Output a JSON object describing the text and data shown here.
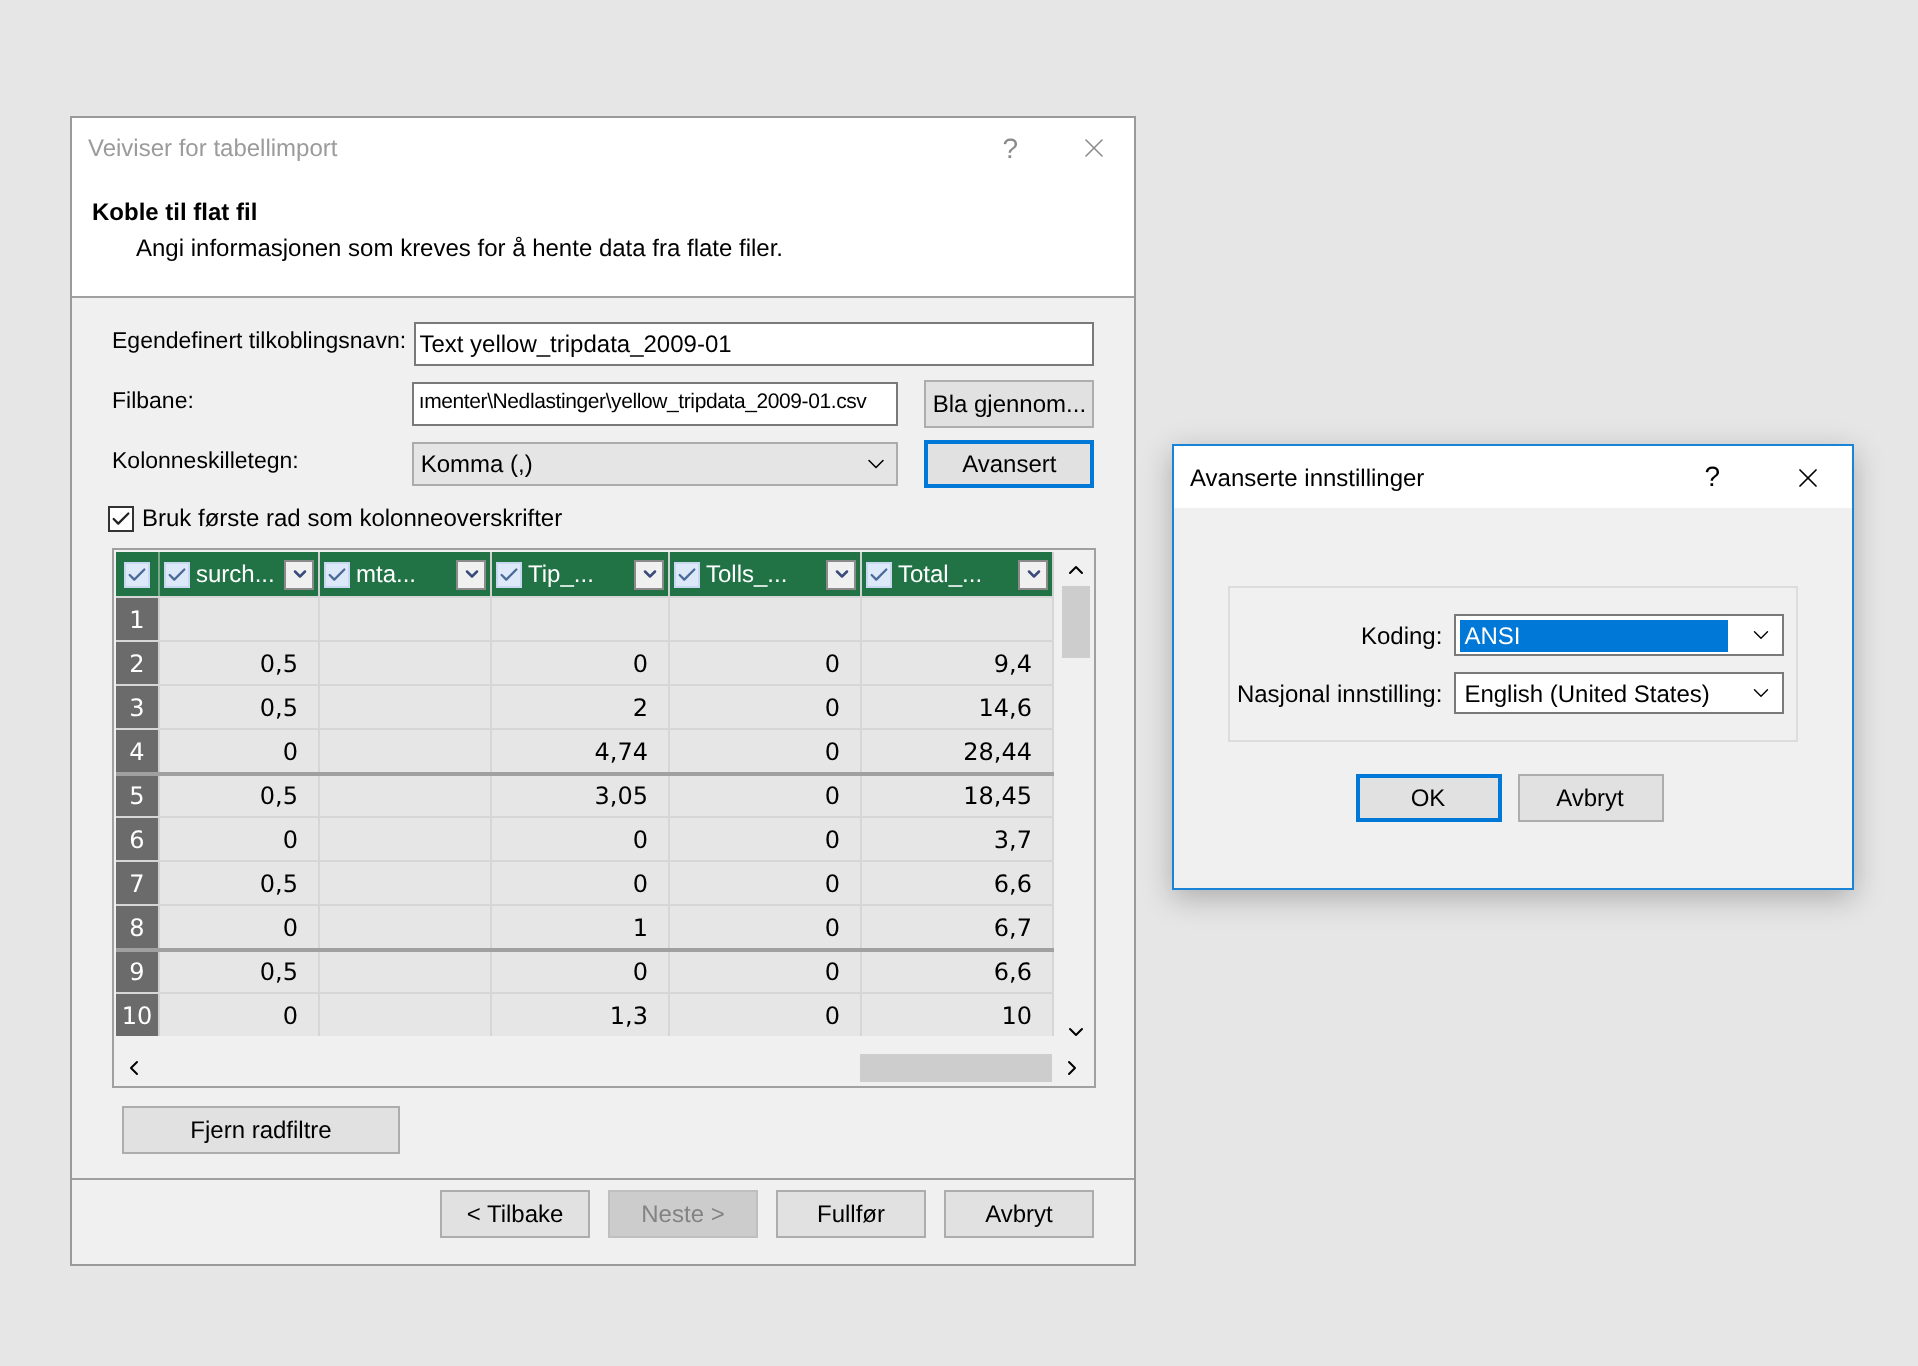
{
  "wizard": {
    "title": "Veiviser for tabellimport",
    "help": "?",
    "heading": "Koble til flat fil",
    "description": "Angi informasjonen som kreves for å hente data fra flate filer.",
    "fields": [
      {
        "kind": "text",
        "label": "Egendefinert tilkoblingsnavn:",
        "value": "Text yellow_tripdata_2009-01"
      },
      {
        "kind": "text",
        "label": "Filbane:",
        "value": "ımenter\\Nedlastinger\\yellow_tripdata_2009-01.csv",
        "button": {
          "label": "Bla gjennom...",
          "focused": false
        }
      },
      {
        "kind": "dropdown",
        "label": "Kolonneskilletegn:",
        "value": "Komma (,)",
        "button": {
          "label": "Avansert",
          "focused": true
        }
      }
    ],
    "header_checkbox": {
      "label": "Bruk første rad som kolonneoverskrifter",
      "checked": true
    },
    "grid": {
      "select_all_checked": true,
      "columns": [
        {
          "label": "surch...",
          "checked": true
        },
        {
          "label": "mta...",
          "checked": true
        },
        {
          "label": "Tip_...",
          "checked": true
        },
        {
          "label": "Tolls_...",
          "checked": true
        },
        {
          "label": "Total_...",
          "checked": true
        }
      ],
      "rows": [
        {
          "number": "1",
          "divider_before": false,
          "cells": [
            null,
            null,
            null,
            null,
            null
          ]
        },
        {
          "number": "2",
          "divider_before": false,
          "cells": [
            "0,5",
            null,
            "0",
            "0",
            "9,4"
          ]
        },
        {
          "number": "3",
          "divider_before": false,
          "cells": [
            "0,5",
            null,
            "2",
            "0",
            "14,6"
          ]
        },
        {
          "number": "4",
          "divider_before": false,
          "cells": [
            "0",
            null,
            "4,74",
            "0",
            "28,44"
          ]
        },
        {
          "number": "5",
          "divider_before": true,
          "cells": [
            "0,5",
            null,
            "3,05",
            "0",
            "18,45"
          ]
        },
        {
          "number": "6",
          "divider_before": false,
          "cells": [
            "0",
            null,
            "0",
            "0",
            "3,7"
          ]
        },
        {
          "number": "7",
          "divider_before": false,
          "cells": [
            "0,5",
            null,
            "0",
            "0",
            "6,6"
          ]
        },
        {
          "number": "8",
          "divider_before": false,
          "cells": [
            "0",
            null,
            "1",
            "0",
            "6,7"
          ]
        },
        {
          "number": "9",
          "divider_before": true,
          "cells": [
            "0,5",
            null,
            "0",
            "0",
            "6,6"
          ]
        },
        {
          "number": "10",
          "divider_before": false,
          "cells": [
            "0",
            null,
            "1,3",
            "0",
            "10"
          ]
        }
      ]
    },
    "filter_button": "Fjern radfiltre",
    "buttons": [
      {
        "label": "< Tilbake",
        "disabled": false
      },
      {
        "label": "Neste >",
        "disabled": true
      },
      {
        "label": "Fullfør",
        "disabled": false
      },
      {
        "label": "Avbryt",
        "disabled": false
      }
    ]
  },
  "advanced": {
    "title": "Avanserte innstillinger",
    "help": "?",
    "fields": [
      {
        "label": "Koding:",
        "value": "ANSI",
        "highlighted": true
      },
      {
        "label": "Nasjonal innstilling:",
        "value": "English (United States)",
        "highlighted": false
      }
    ],
    "buttons": [
      {
        "label": "OK",
        "focused": true
      },
      {
        "label": "Avbryt",
        "focused": false
      }
    ]
  }
}
